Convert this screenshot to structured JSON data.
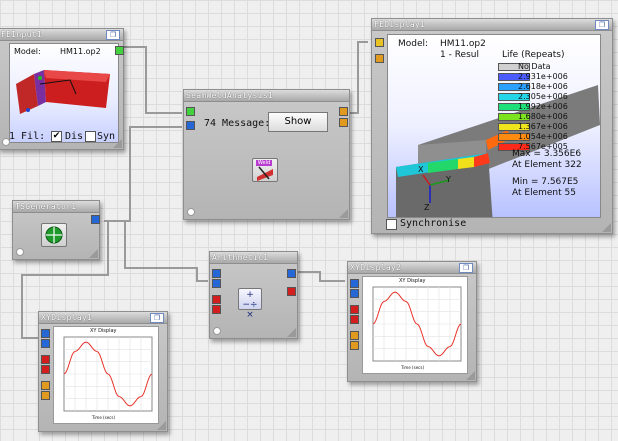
{
  "nodes": {
    "fe_input": {
      "title": "FEInput1",
      "model_label": "Model:",
      "model_value": "HM11.op2",
      "files_text": "1 Fil:",
      "display_label": "Dis",
      "sync_label": "Syn",
      "display_checked": "✔"
    },
    "seam_weld": {
      "title": "SeamWeldAnalysis1",
      "messages_text": "74 Message:",
      "show_label": "Show",
      "icon_label": "Weld"
    },
    "fe_display": {
      "title": "FEDisplay1",
      "model_label": "Model:",
      "model_value": "HM11.op2",
      "result_text": "1 - Resul",
      "life_label": "Life (Repeats)",
      "legend": [
        "No Data",
        "2.931e+006",
        "2.618e+006",
        "2.305e+006",
        "1.992e+006",
        "1.680e+006",
        "1.367e+006",
        "1.054e+006",
        "7.567e+005"
      ],
      "legend_colors": [
        "#d0d0d0",
        "#4a5cff",
        "#2aa0ff",
        "#23d6e8",
        "#1ee07a",
        "#7be41e",
        "#f0e51c",
        "#ff8a10",
        "#ff2a1a"
      ],
      "max_text": "Max = 3.356E6",
      "max_elem": "At Element 322",
      "min_text": "Min = 7.567E5",
      "min_elem": "At Element 55",
      "synchronise_label": "Synchronise",
      "axis_x": "X",
      "axis_y": "Y",
      "axis_z": "Z"
    },
    "ts_generator": {
      "title": "TSGenerator1"
    },
    "arithmetic": {
      "title": "Arithmetic1",
      "symbols": "+−÷×"
    },
    "xy_display1": {
      "title": "XYDisplay1",
      "plot_title": "XY Display",
      "x_label": "Time (secs)"
    },
    "xy_display2": {
      "title": "XYDisplay2",
      "plot_title": "XY Display",
      "x_label": "Time (secs)"
    }
  },
  "colors": {
    "port_green": "#43d13f",
    "port_blue": "#2667d8",
    "port_red": "#d21e1e",
    "port_orange": "#e09a1f",
    "sine_line": "#e8332a"
  },
  "chart_data": [
    {
      "type": "line",
      "x": [
        0,
        0.125,
        0.25,
        0.375,
        0.5,
        0.625,
        0.75,
        0.875,
        1
      ],
      "series": [
        {
          "values": [
            0,
            0.707,
            1,
            0.707,
            0,
            -0.707,
            -1,
            -0.707,
            0
          ]
        }
      ],
      "title": "XY Display",
      "xlabel": "Time (secs)",
      "grid": true
    },
    {
      "type": "line",
      "x": [
        0,
        0.125,
        0.25,
        0.375,
        0.5,
        0.625,
        0.75,
        0.875,
        1
      ],
      "series": [
        {
          "values": [
            0,
            0.707,
            1,
            0.707,
            0,
            -0.707,
            -1,
            -0.707,
            0
          ]
        }
      ],
      "title": "XY Display",
      "xlabel": "Time (secs)",
      "grid": true
    }
  ]
}
